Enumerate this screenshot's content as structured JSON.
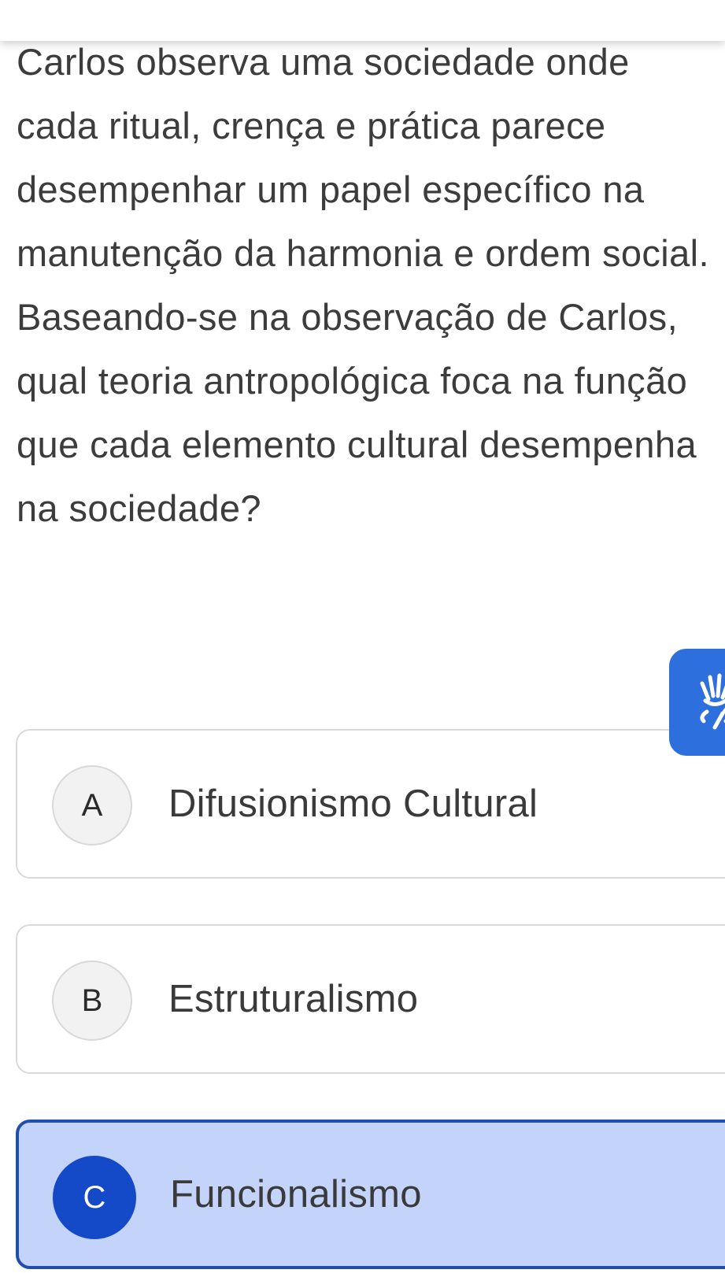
{
  "question": {
    "text": "Carlos observa uma sociedade onde cada ritual, crença e prática parece desempenhar um papel específico na manutenção da harmonia e ordem social. Baseando-se na observação de Carlos, qual teoria antropológica foca na função que cada elemento cultural desempenha na sociedade?"
  },
  "accessibility": {
    "icon": "sign-language-hands-icon",
    "color": "#2d6fdc"
  },
  "options": [
    {
      "letter": "A",
      "text": "Difusionismo Cultural",
      "selected": false
    },
    {
      "letter": "B",
      "text": "Estruturalismo",
      "selected": false
    },
    {
      "letter": "C",
      "text": "Funcionalismo",
      "selected": true
    }
  ],
  "colors": {
    "selected_background": "#c4d3fa",
    "selected_border": "#1f4fad",
    "selected_letter_background": "#1449c7"
  }
}
